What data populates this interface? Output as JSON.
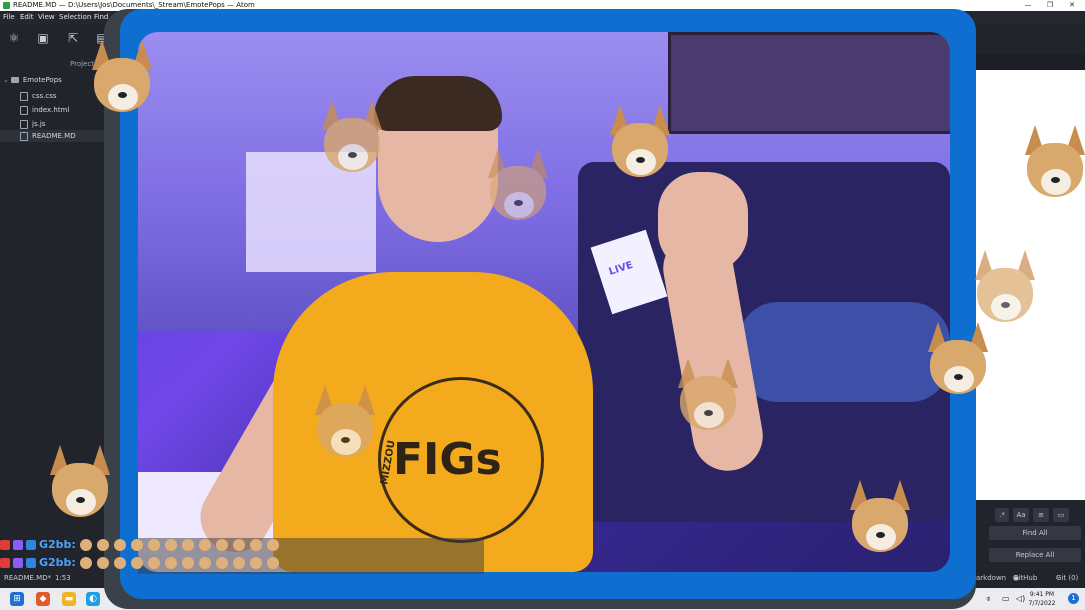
{
  "window": {
    "title": "README.MD — D:\\Users\\Jos\\Documents\\_Stream\\EmotePops — Atom",
    "controls": [
      "—",
      "❐",
      "✕"
    ]
  },
  "menu": [
    "File",
    "Edit",
    "View",
    "Selection",
    "Find"
  ],
  "tree": {
    "header": "Project",
    "root": "EmotePops",
    "files": [
      "css.css",
      "index.html",
      "js.js",
      "README.MD"
    ],
    "selected": "README.MD"
  },
  "overlay": {
    "shirt_small": "MIZZOU",
    "shirt_big": "FIGs",
    "paper_text": "LIVE"
  },
  "chat": {
    "messages": [
      {
        "user": "G2bb:"
      },
      {
        "user": "G2bb:"
      }
    ]
  },
  "find": {
    "find_all": "Find All",
    "replace_all": "Replace All",
    "option_aa": "Aa"
  },
  "status": {
    "file": "README.MD*",
    "position": "1:53",
    "grammar": "arkdown",
    "github": "GitHub",
    "git": "Git (0)"
  },
  "clock": {
    "time": "9:41 PM",
    "date": "7/7/2022"
  },
  "colors": {
    "frame_blue": "#0e6fd0",
    "shirt": "#f4aa1d",
    "chat_name": "#4aa3ff"
  }
}
